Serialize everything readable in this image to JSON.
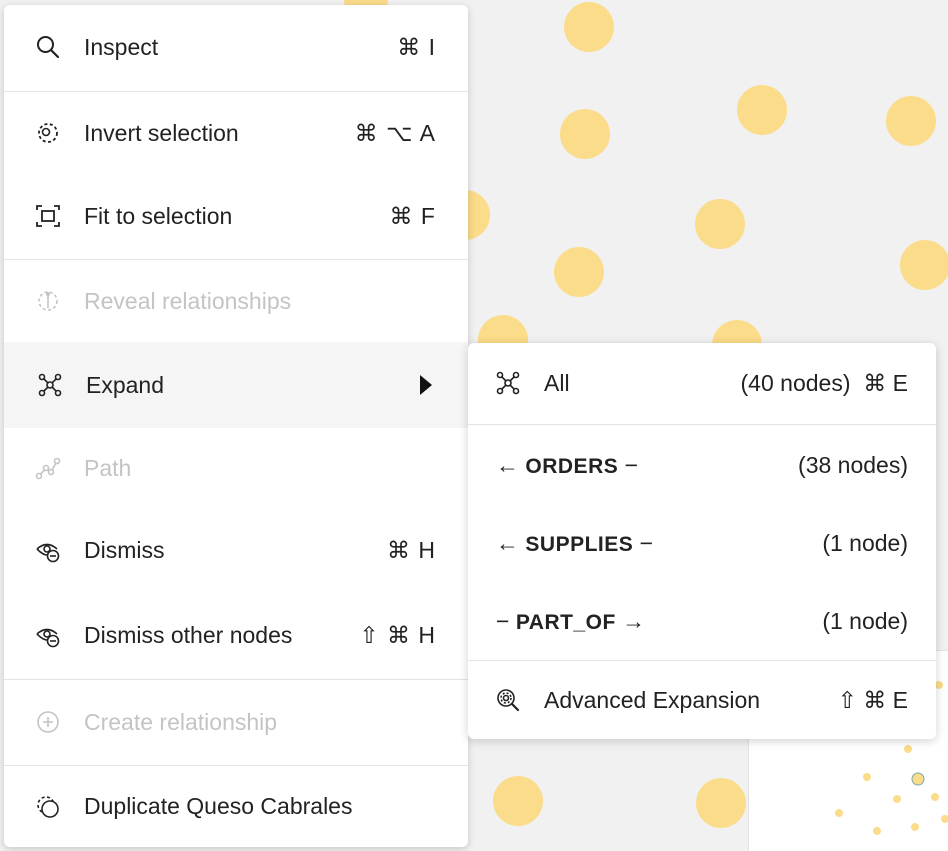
{
  "context_menu": {
    "items": [
      {
        "label": "Inspect",
        "shortcut": "⌘ I",
        "icon": "search-icon",
        "enabled": true
      },
      {
        "label": "Invert selection",
        "shortcut": "⌘ ⌥ A",
        "icon": "invert-selection-icon",
        "enabled": true
      },
      {
        "label": "Fit to selection",
        "shortcut": "⌘ F",
        "icon": "fit-selection-icon",
        "enabled": true
      },
      {
        "label": "Reveal relationships",
        "shortcut": "",
        "icon": "reveal-relationships-icon",
        "enabled": false
      },
      {
        "label": "Expand",
        "shortcut": "",
        "icon": "expand-graph-icon",
        "enabled": true,
        "has_submenu": true
      },
      {
        "label": "Path",
        "shortcut": "",
        "icon": "path-icon",
        "enabled": false
      },
      {
        "label": "Dismiss",
        "shortcut": "⌘ H",
        "icon": "dismiss-icon",
        "enabled": true
      },
      {
        "label": "Dismiss other nodes",
        "shortcut": "⇧ ⌘ H",
        "icon": "dismiss-others-icon",
        "enabled": true
      },
      {
        "label": "Create relationship",
        "shortcut": "",
        "icon": "add-circle-icon",
        "enabled": false
      },
      {
        "label": "Duplicate Queso Cabrales",
        "shortcut": "",
        "icon": "duplicate-icon",
        "enabled": true
      }
    ]
  },
  "expand_submenu": {
    "all": {
      "label": "All",
      "count": "(40 nodes)",
      "shortcut": "⌘ E"
    },
    "relationships": [
      {
        "prefix": "←",
        "name": "ORDERS",
        "suffix": "−",
        "count": "(38 nodes)"
      },
      {
        "prefix": "←",
        "name": "SUPPLIES",
        "suffix": "−",
        "count": "(1 node)"
      },
      {
        "prefix": "−",
        "name": "PART_OF",
        "suffix": "→",
        "count": "(1 node)"
      }
    ],
    "advanced": {
      "label": "Advanced Expansion",
      "shortcut": "⇧ ⌘ E"
    }
  },
  "colors": {
    "node_fill": "#fbdc8a",
    "canvas_bg": "#f1f1f1",
    "disabled_text": "#c4c4c4"
  }
}
